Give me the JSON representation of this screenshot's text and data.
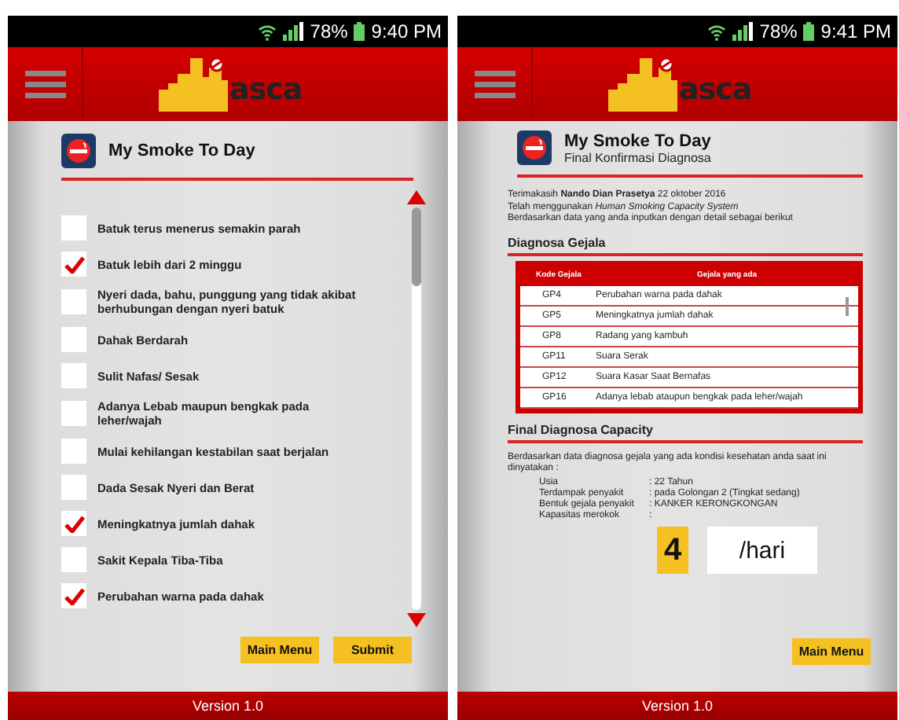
{
  "phones": [
    {
      "kind": "symptoms",
      "status": {
        "battery": "78%",
        "time": "9:40 PM"
      },
      "logo": "asca",
      "title": "My Smoke To Day",
      "symptoms": [
        {
          "label": "Batuk terus menerus semakin parah",
          "checked": false
        },
        {
          "label": "Batuk lebih dari 2 minggu",
          "checked": true
        },
        {
          "label": "Nyeri dada, bahu, punggung yang tidak akibat berhubungan dengan nyeri batuk",
          "checked": false
        },
        {
          "label": "Dahak Berdarah",
          "checked": false
        },
        {
          "label": "Sulit Nafas/ Sesak",
          "checked": false
        },
        {
          "label": "Adanya Lebab maupun bengkak pada leher/wajah",
          "checked": false
        },
        {
          "label": "Mulai kehilangan kestabilan saat berjalan",
          "checked": false
        },
        {
          "label": "Dada Sesak Nyeri dan Berat",
          "checked": false
        },
        {
          "label": "Meningkatnya jumlah dahak",
          "checked": true
        },
        {
          "label": "Sakit Kepala Tiba-Tiba",
          "checked": false
        },
        {
          "label": "Perubahan warna pada dahak",
          "checked": true
        }
      ],
      "buttons": [
        "Main Menu",
        "Submit"
      ],
      "footer": "Version 1.0"
    },
    {
      "kind": "diagnosis",
      "status": {
        "battery": "78%",
        "time": "9:41 PM"
      },
      "logo": "asca",
      "title": "My Smoke To Day",
      "subtitle": "Final Konfirmasi Diagnosa",
      "intro": [
        "Terimakasih **Nando Dian Prasetya**  22 oktober 2016",
        "Telah menggunakan *Human Smoking Capacity System*",
        "Berdasarkan data yang anda inputkan dengan detail sebagai berikut"
      ],
      "section_1": "Diagnosa Gejala",
      "table": {
        "columns": [
          "Kode Gejala",
          "Gejala yang ada"
        ],
        "rows": [
          [
            "GP4",
            "Perubahan warna pada dahak"
          ],
          [
            "GP5",
            "Meningkatnya jumlah dahak"
          ],
          [
            "GP8",
            "Radang yang kambuh"
          ],
          [
            "GP11",
            "Suara Serak"
          ],
          [
            "GP12",
            "Suara Kasar Saat Bernafas"
          ],
          [
            "GP16",
            "Adanya lebab ataupun bengkak pada leher/wajah"
          ]
        ]
      },
      "section_2": "Final Diagnosa Capacity",
      "summary": "Berdasarkan data diagnosa gejala yang ada kondisi kesehatan anda saat ini dinyatakan :",
      "fields": [
        {
          "label": "Usia",
          "value": ": 22 Tahun"
        },
        {
          "label": "Terdampak penyakit",
          "value": ": pada Golongan 2 (Tingkat sedang)"
        },
        {
          "label": "Bentuk gejala penyakit",
          "value": ": KANKER KERONGKONGAN"
        },
        {
          "label": "Kapasitas merokok",
          "value": ":"
        }
      ],
      "capacity": "4",
      "unit": "/hari",
      "buttons": [
        "Main Menu"
      ],
      "footer": "Version 1.0"
    }
  ]
}
